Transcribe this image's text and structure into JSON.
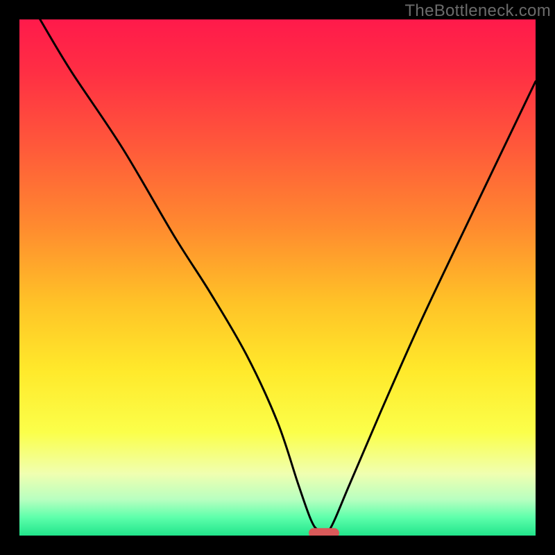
{
  "watermark": "TheBottleneck.com",
  "colors": {
    "frame": "#000000",
    "curve": "#000000",
    "marker_fill": "#d95a5a",
    "gradient_stops": [
      {
        "offset": 0.0,
        "color": "#ff1a4b"
      },
      {
        "offset": 0.1,
        "color": "#ff2e44"
      },
      {
        "offset": 0.25,
        "color": "#ff5a3a"
      },
      {
        "offset": 0.4,
        "color": "#ff8a2f"
      },
      {
        "offset": 0.55,
        "color": "#ffc327"
      },
      {
        "offset": 0.68,
        "color": "#ffe92b"
      },
      {
        "offset": 0.8,
        "color": "#fbff4a"
      },
      {
        "offset": 0.88,
        "color": "#f0ffb0"
      },
      {
        "offset": 0.93,
        "color": "#b8ffc0"
      },
      {
        "offset": 0.965,
        "color": "#5dffab"
      },
      {
        "offset": 1.0,
        "color": "#21e58b"
      }
    ]
  },
  "chart_data": {
    "type": "line",
    "title": "",
    "xlabel": "",
    "ylabel": "",
    "xlim": [
      0,
      100
    ],
    "ylim": [
      0,
      100
    ],
    "grid": false,
    "series": [
      {
        "name": "bottleneck-curve",
        "x": [
          4,
          10,
          20,
          30,
          37,
          44,
          50,
          54,
          56.5,
          58,
          60,
          64,
          70,
          78,
          88,
          100
        ],
        "values": [
          100,
          90,
          75,
          58,
          47,
          35,
          22,
          10,
          3,
          1,
          1,
          10,
          24,
          42,
          63,
          88
        ]
      }
    ],
    "annotations": [
      {
        "name": "optimal-marker",
        "x": 59,
        "y": 0.5,
        "shape": "pill"
      }
    ],
    "legend": false
  }
}
